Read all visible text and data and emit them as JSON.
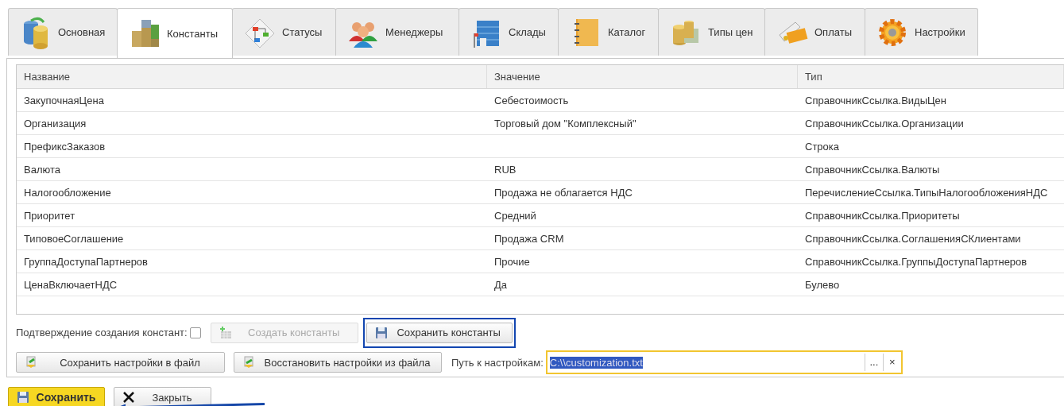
{
  "tabs": [
    {
      "label": "Основная",
      "selected": false
    },
    {
      "label": "Константы",
      "selected": true
    },
    {
      "label": "Статусы",
      "selected": false
    },
    {
      "label": "Менеджеры",
      "selected": false
    },
    {
      "label": "Склады",
      "selected": false
    },
    {
      "label": "Каталог",
      "selected": false
    },
    {
      "label": "Типы цен",
      "selected": false
    },
    {
      "label": "Оплаты",
      "selected": false
    },
    {
      "label": "Настройки",
      "selected": false
    }
  ],
  "table": {
    "columns": [
      "Название",
      "Значение",
      "Тип"
    ],
    "rows": [
      [
        "ЗакупочнаяЦена",
        "Себестоимость",
        "СправочникСсылка.ВидыЦен"
      ],
      [
        "Организация",
        "Торговый дом \"Комплексный\"",
        "СправочникСсылка.Организации"
      ],
      [
        "ПрефиксЗаказов",
        "",
        "Строка"
      ],
      [
        "Валюта",
        "RUB",
        "СправочникСсылка.Валюты"
      ],
      [
        "Налогообложение",
        "Продажа не облагается НДС",
        "ПеречислениеСсылка.ТипыНалогообложенияНДС"
      ],
      [
        "Приоритет",
        "Средний",
        "СправочникСсылка.Приоритеты"
      ],
      [
        "ТиповоеСоглашение",
        "Продажа CRM",
        "СправочникСсылка.СоглашенияСКлиентами"
      ],
      [
        "ГруппаДоступаПартнеров",
        "Прочие",
        "СправочникСсылка.ГруппыДоступаПартнеров"
      ],
      [
        "ЦенаВключаетНДС",
        "Да",
        "Булево"
      ]
    ]
  },
  "confirm": {
    "label": "Подтверждение создания констант:",
    "checked": false
  },
  "create_button": {
    "label": "Создать константы",
    "disabled": true
  },
  "save_constants_button": {
    "label": "Сохранить константы",
    "disabled": false
  },
  "save_file_button": {
    "label": "Сохранить настройки в файл"
  },
  "restore_button": {
    "label": "Восстановить настройки из файла"
  },
  "path": {
    "label": "Путь к настройкам:",
    "value": "C:\\\\customization.txt",
    "choose": "...",
    "clear": "×"
  },
  "footer": {
    "save": "Сохранить",
    "close": "Закрыть"
  }
}
